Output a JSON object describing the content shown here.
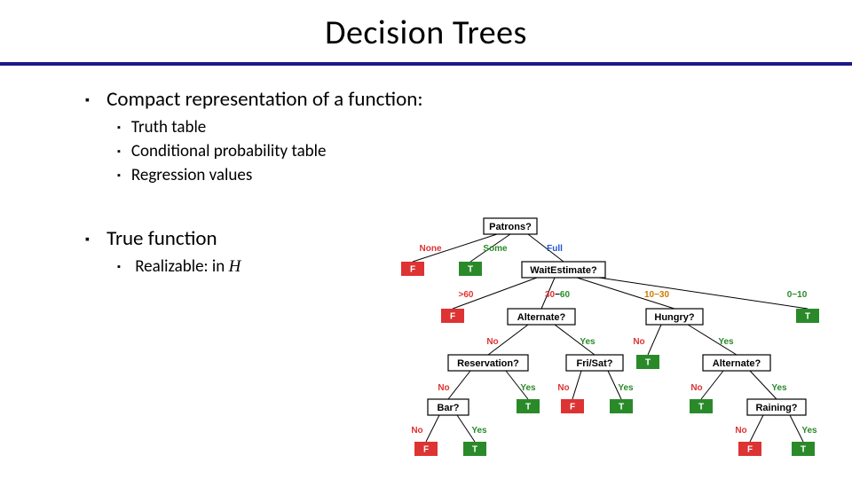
{
  "title": "Decision Trees",
  "bullets": {
    "b1": "Compact representation of a function:",
    "b1a": "Truth table",
    "b1b": "Conditional probability table",
    "b1c": "Regression values",
    "b2": "True function",
    "b2a_prefix": "Realizable: in ",
    "b2a_sym": "H"
  },
  "chart_data": {
    "type": "diagram",
    "title": "",
    "nodes": {
      "root": "Patrons?",
      "waitest": "WaitEstimate?",
      "alternate1": "Alternate?",
      "hungry": "Hungry?",
      "reservation": "Reservation?",
      "frisat": "Fri/Sat?",
      "alternate2": "Alternate?",
      "bar": "Bar?",
      "raining": "Raining?"
    },
    "edges": {
      "root_none": "None",
      "root_some": "Some",
      "root_full": "Full",
      "wait_gt60": ">60",
      "wait_30_60": "30−60",
      "wait_10_30": "10−30",
      "wait_0_10": "0−10",
      "no": "No",
      "yes": "Yes"
    },
    "leaves": {
      "T": "T",
      "F": "F"
    }
  }
}
